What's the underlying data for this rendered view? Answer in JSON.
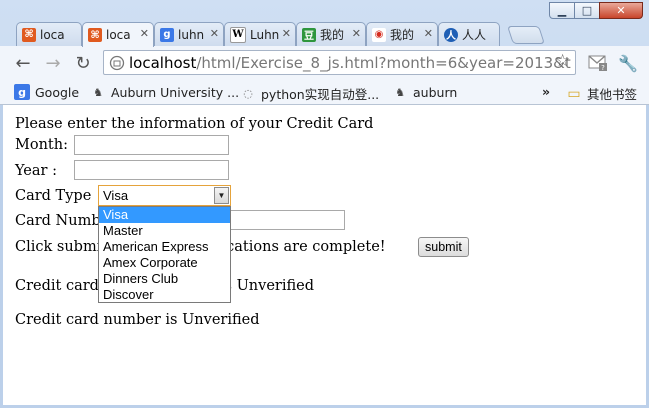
{
  "browser": {
    "tabs": [
      {
        "label": "loca",
        "favicon": "xampp-icon",
        "color": "#e05a1f",
        "glyph": "⌘"
      },
      {
        "label": "loca",
        "favicon": "xampp-icon",
        "color": "#e05a1f",
        "glyph": "⌘",
        "active": true
      },
      {
        "label": "luhn",
        "favicon": "google-icon",
        "color": "#3b78e7",
        "glyph": "g"
      },
      {
        "label": "Luhn",
        "favicon": "wikipedia-icon",
        "color": "#ffffff",
        "glyph": "W"
      },
      {
        "label": "我的",
        "favicon": "douban-icon",
        "color": "#2e963d",
        "glyph": "豆"
      },
      {
        "label": "我的",
        "favicon": "weibo-icon",
        "color": "#ffffff",
        "glyph": "◉"
      },
      {
        "label": "人人",
        "favicon": "renren-icon",
        "color": "#1f5fb5",
        "glyph": "人"
      }
    ],
    "url_host": "localhost",
    "url_path": "/html/Exercise_8_js.html?month=6&year=2013&t",
    "bookmarks": [
      {
        "label": "Google",
        "icon": "google-icon"
      },
      {
        "label": "Auburn University ...",
        "icon": "tiger-icon"
      },
      {
        "label": "python实现自动登...",
        "icon": "page-icon"
      },
      {
        "label": "auburn",
        "icon": "tiger-icon"
      }
    ],
    "other_bookmarks": "其他书签",
    "overflow": "»"
  },
  "form": {
    "intro": "Please enter the information of your Credit Card",
    "month_label": "Month:",
    "month_value": "",
    "year_label": "Year :",
    "year_value": "",
    "card_type_label": "Card Type",
    "card_type_selected": "Visa",
    "card_type_options": [
      "Visa",
      "Master",
      "American Express",
      "Amex Corporate",
      "Dinners Club",
      "Discover"
    ],
    "card_number_label": "Card Number",
    "card_number_value": "",
    "submit_prompt": "Click submit after the modifications are complete!",
    "submit_label": "submit"
  },
  "results": {
    "line1": "Credit card expiration date is Unverified",
    "line2": "Credit card number is Unverified"
  }
}
